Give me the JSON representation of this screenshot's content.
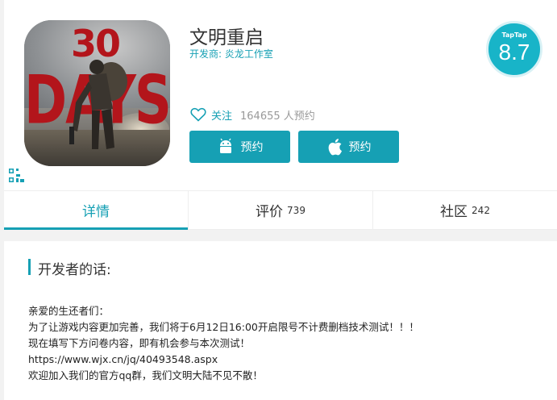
{
  "app": {
    "title": "文明重启",
    "developer": "开发商: 炎龙工作室",
    "icon_text_top": "30",
    "icon_text_bottom": "DAYS"
  },
  "score": {
    "brand": "TapTap",
    "value": "8.7"
  },
  "follow": {
    "label": "关注",
    "reservations": "164655 人预约"
  },
  "buttons": {
    "android_label": "预约",
    "ios_label": "预约"
  },
  "tabs": [
    {
      "label": "详情",
      "count": ""
    },
    {
      "label": "评价",
      "count": "739"
    },
    {
      "label": "社区",
      "count": "242"
    }
  ],
  "content": {
    "section_title": "开发者的话:",
    "lines": [
      "亲爱的生还者们：",
      "为了让游戏内容更加完善，我们将于6月12日16:00开启限号不计费删档技术测试！！！",
      "现在填写下方问卷内容，即有机会参与本次测试！",
      "https://www.wjx.cn/jq/40493548.aspx",
      "欢迎加入我们的官方qq群，我们文明大陆不见不散！"
    ]
  },
  "colors": {
    "accent": "#16a0b4",
    "score_bg": "#18b4c8",
    "icon_red": "#b3151b"
  },
  "icons": [
    "heart-icon",
    "android-icon",
    "apple-icon",
    "qr-code-icon"
  ]
}
